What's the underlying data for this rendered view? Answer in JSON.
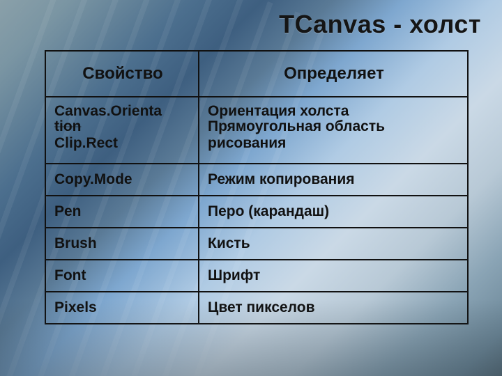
{
  "title": "TCanvas - холст",
  "table": {
    "header": {
      "prop": "Свойство",
      "def": "Определяет"
    },
    "merged": {
      "prop_line1": "Canvas.Orienta",
      "prop_line2": "tion",
      "prop_line3": "Clip.Rect",
      "def_line1": "Ориентация холста",
      "def_line2": "Прямоугольная область",
      "def_line3": "рисования"
    },
    "rows": [
      {
        "prop": "Copy.Mode",
        "def": "Режим копирования"
      },
      {
        "prop": "Pen",
        "def": "Перо (карандаш)"
      },
      {
        "prop": "Brush",
        "def": "Кисть"
      },
      {
        "prop": "Font",
        "def": "Шрифт"
      },
      {
        "prop": "Pixels",
        "def": "Цвет пикселов"
      }
    ]
  }
}
